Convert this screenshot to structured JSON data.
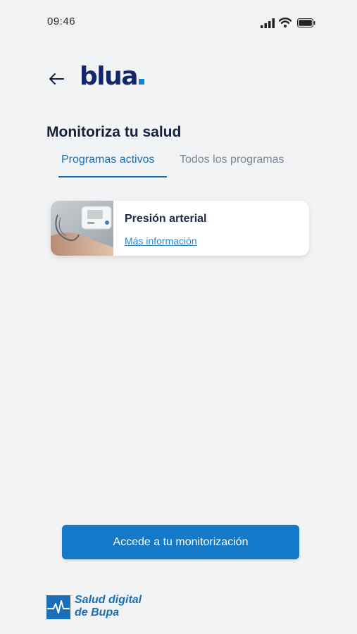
{
  "status_bar": {
    "time": "09:46",
    "icons": [
      "signal-icon",
      "wifi-icon",
      "battery-icon"
    ]
  },
  "header": {
    "back_icon": "arrow-left-icon",
    "logo_text": "blua",
    "logo_dot_color": "#1a7fd4"
  },
  "main": {
    "title": "Monitoriza tu salud",
    "tabs": [
      {
        "label": "Programas activos",
        "active": true
      },
      {
        "label": "Todos los programas",
        "active": false
      }
    ],
    "programs": [
      {
        "title": "Presión arterial",
        "link_label": "Más información",
        "image": "blood-pressure-monitor-photo"
      }
    ]
  },
  "actions": {
    "primary_label": "Accede a tu monitorización"
  },
  "footer": {
    "brand_line1": "Salud digital",
    "brand_line2": "de Bupa",
    "brand_icon": "heartbeat-icon"
  },
  "colors": {
    "background": "#f2f3f5",
    "primary": "#1479c9",
    "navy": "#12266a",
    "tab_active": "#1a6fb8",
    "tab_inactive": "#7d8794"
  }
}
